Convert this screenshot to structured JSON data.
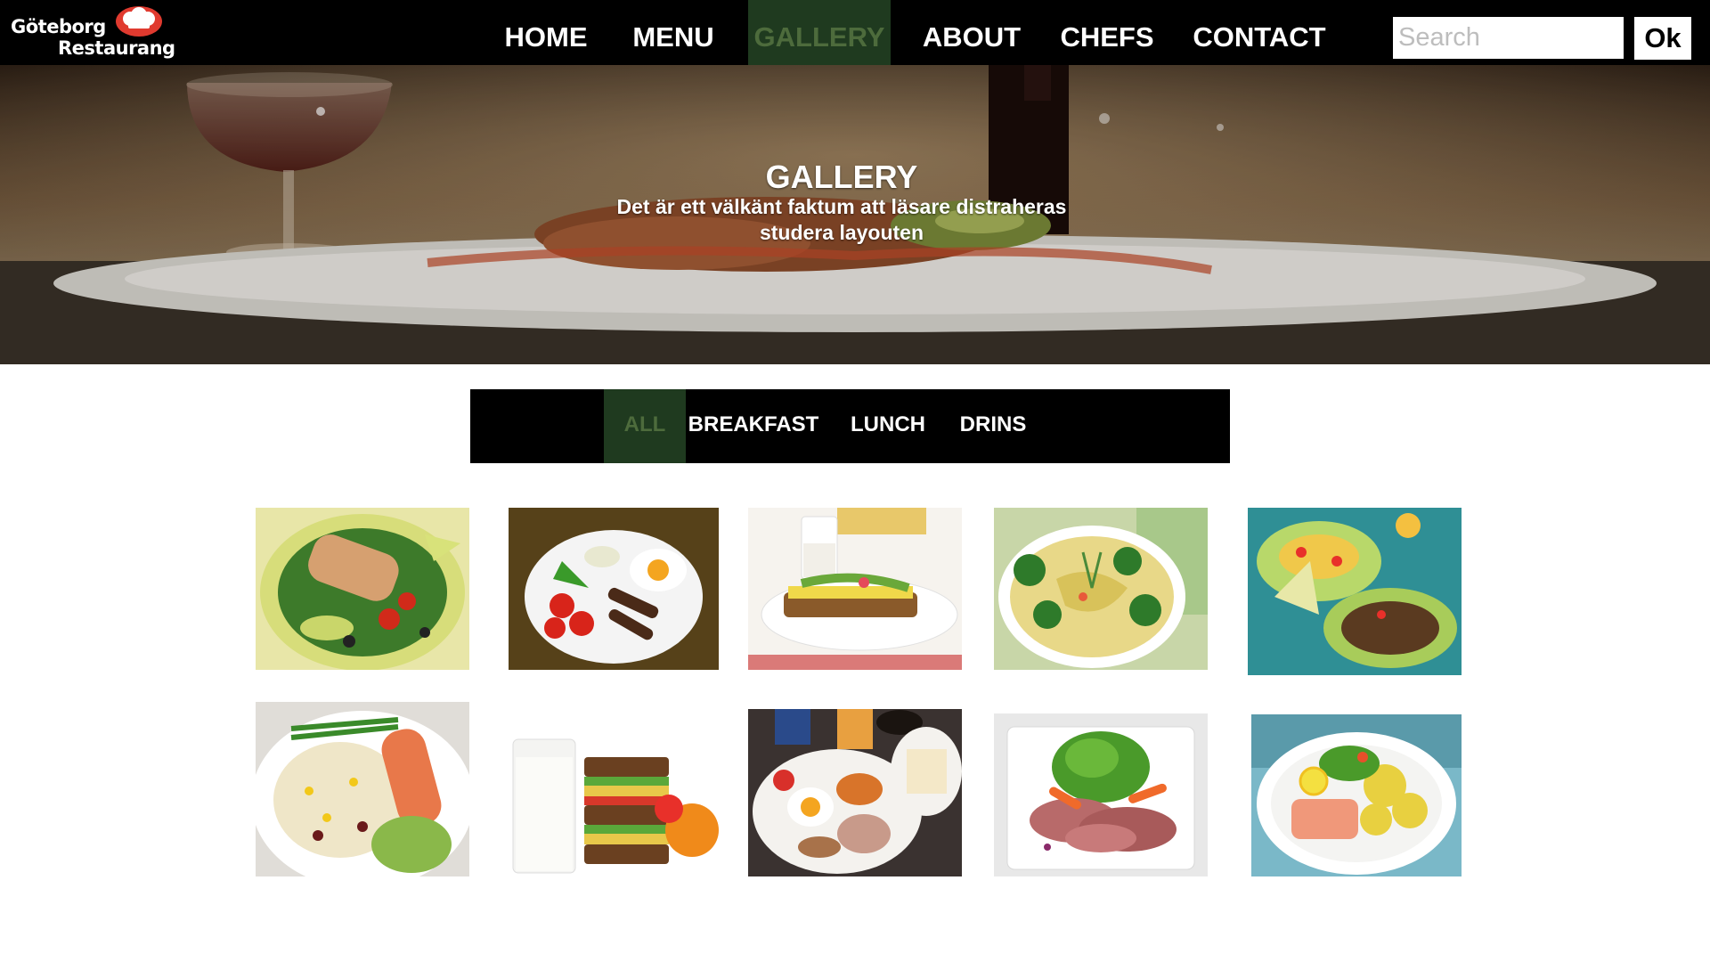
{
  "logo": {
    "line1": "Göteborg",
    "line2": "Restaurang"
  },
  "nav": {
    "items": [
      {
        "label": "HOME"
      },
      {
        "label": "MENU"
      },
      {
        "label": "GALLERY"
      },
      {
        "label": "ABOUT"
      },
      {
        "label": "CHEFS"
      },
      {
        "label": "CONTACT"
      }
    ],
    "active": "GALLERY"
  },
  "search": {
    "placeholder": "Search",
    "value": "",
    "button_label": "Ok"
  },
  "hero": {
    "title": "GALLERY",
    "subtitle": "Det är ett välkänt faktum att läsare distraheras studera layouten"
  },
  "filters": {
    "items": [
      {
        "label": "ALL"
      },
      {
        "label": "BREAKFAST"
      },
      {
        "label": "LUNCH"
      },
      {
        "label": "DRINS"
      }
    ],
    "active": "ALL"
  },
  "gallery": {
    "photos": [
      {
        "icon": "chicken-avocado-salad-photo"
      },
      {
        "icon": "eggs-sausage-tomato-photo"
      },
      {
        "icon": "milk-cheese-sandwich-photo"
      },
      {
        "icon": "broccoli-pasta-salad-photo"
      },
      {
        "icon": "lettuce-wrap-minced-meat-photo"
      },
      {
        "icon": "salmon-rice-beans-photo"
      },
      {
        "icon": "milk-sandwich-orange-photo"
      },
      {
        "icon": "english-breakfast-photo"
      },
      {
        "icon": "roast-beef-salad-photo"
      },
      {
        "icon": "salmon-potatoes-photo"
      }
    ]
  },
  "colors": {
    "nav_background": "#000000",
    "active_background": "#1f3a1f",
    "active_text": "#4d6b3c",
    "text": "#ffffff",
    "page_background": "#ffffff"
  }
}
